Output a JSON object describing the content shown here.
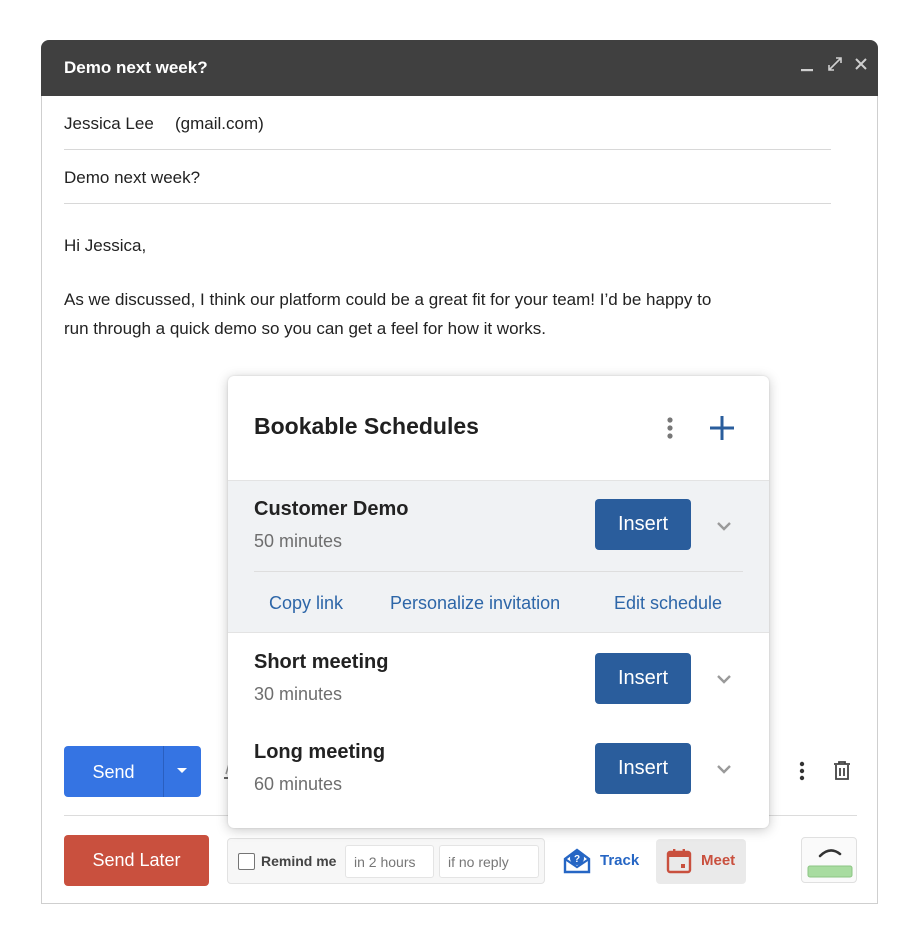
{
  "window": {
    "title": "Demo next week?",
    "controls": {
      "minimize": "minimize-icon",
      "expand": "expand-icon",
      "close": "close-icon"
    }
  },
  "compose": {
    "to": {
      "name": "Jessica Lee",
      "domain": "(gmail.com)"
    },
    "subject": "Demo next week?",
    "greeting": "Hi Jessica,",
    "body_line1": "As we discussed, I think our platform could be a great fit for your team! I’d be happy to",
    "body_line2": "run through a quick demo so you can get a feel for how it works."
  },
  "toolbar": {
    "send_label": "Send",
    "send_later_label": "Send Later",
    "remind": {
      "label": "Remind me",
      "checked": false,
      "time": "in 2 hours",
      "condition": "if no reply"
    },
    "track_label": "Track",
    "meet_label": "Meet"
  },
  "popup": {
    "title": "Bookable Schedules",
    "schedules": [
      {
        "name": "Customer Demo",
        "duration": "50 minutes",
        "insert_label": "Insert",
        "expanded": true,
        "actions": [
          "Copy link",
          "Personalize invitation",
          "Edit schedule"
        ]
      },
      {
        "name": "Short meeting",
        "duration": "30 minutes",
        "insert_label": "Insert",
        "expanded": false
      },
      {
        "name": "Long meeting",
        "duration": "60 minutes",
        "insert_label": "Insert",
        "expanded": false
      }
    ]
  },
  "colors": {
    "titlebar": "#404040",
    "send": "#3574e3",
    "send_later": "#c9503e",
    "insert": "#2a5d9c",
    "link": "#2d66a8",
    "track": "#2666c4",
    "meet": "#c9503e"
  }
}
